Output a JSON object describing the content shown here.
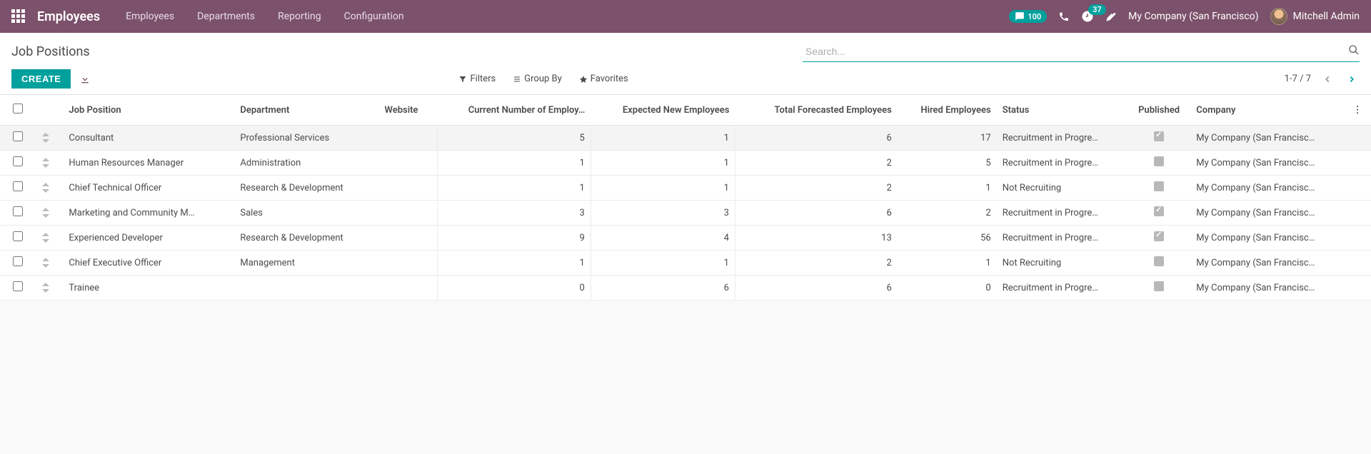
{
  "navbar": {
    "brand": "Employees",
    "menu": [
      "Employees",
      "Departments",
      "Reporting",
      "Configuration"
    ],
    "messages_count": "100",
    "activities_count": "37",
    "company": "My Company (San Francisco)",
    "user": "Mitchell Admin"
  },
  "control": {
    "breadcrumb": "Job Positions",
    "create_label": "CREATE",
    "search_placeholder": "Search...",
    "filters_label": "Filters",
    "groupby_label": "Group By",
    "favorites_label": "Favorites",
    "pager": "1-7 / 7"
  },
  "table": {
    "headers": {
      "job_position": "Job Position",
      "department": "Department",
      "website": "Website",
      "current": "Current Number of Employ…",
      "expected": "Expected New Employees",
      "forecasted": "Total Forecasted Employees",
      "hired": "Hired Employees",
      "status": "Status",
      "published": "Published",
      "company": "Company"
    },
    "rows": [
      {
        "job": "Consultant",
        "dept": "Professional Services",
        "web": "",
        "curr": "5",
        "exp": "1",
        "fore": "6",
        "hired": "17",
        "status": "Recruitment in Progre…",
        "pub": true,
        "company": "My Company (San Francisc…",
        "selected": true
      },
      {
        "job": "Human Resources Manager",
        "dept": "Administration",
        "web": "",
        "curr": "1",
        "exp": "1",
        "fore": "2",
        "hired": "5",
        "status": "Recruitment in Progre…",
        "pub": false,
        "company": "My Company (San Francisc…",
        "selected": false
      },
      {
        "job": "Chief Technical Officer",
        "dept": "Research & Development",
        "web": "",
        "curr": "1",
        "exp": "1",
        "fore": "2",
        "hired": "1",
        "status": "Not Recruiting",
        "pub": false,
        "company": "My Company (San Francisc…",
        "selected": false
      },
      {
        "job": "Marketing and Community M…",
        "dept": "Sales",
        "web": "",
        "curr": "3",
        "exp": "3",
        "fore": "6",
        "hired": "2",
        "status": "Recruitment in Progre…",
        "pub": true,
        "company": "My Company (San Francisc…",
        "selected": false
      },
      {
        "job": "Experienced Developer",
        "dept": "Research & Development",
        "web": "",
        "curr": "9",
        "exp": "4",
        "fore": "13",
        "hired": "56",
        "status": "Recruitment in Progre…",
        "pub": true,
        "company": "My Company (San Francisc…",
        "selected": false
      },
      {
        "job": "Chief Executive Officer",
        "dept": "Management",
        "web": "",
        "curr": "1",
        "exp": "1",
        "fore": "2",
        "hired": "1",
        "status": "Not Recruiting",
        "pub": false,
        "company": "My Company (San Francisc…",
        "selected": false
      },
      {
        "job": "Trainee",
        "dept": "",
        "web": "",
        "curr": "0",
        "exp": "6",
        "fore": "6",
        "hired": "0",
        "status": "Recruitment in Progre…",
        "pub": false,
        "company": "My Company (San Francisc…",
        "selected": false
      }
    ]
  }
}
